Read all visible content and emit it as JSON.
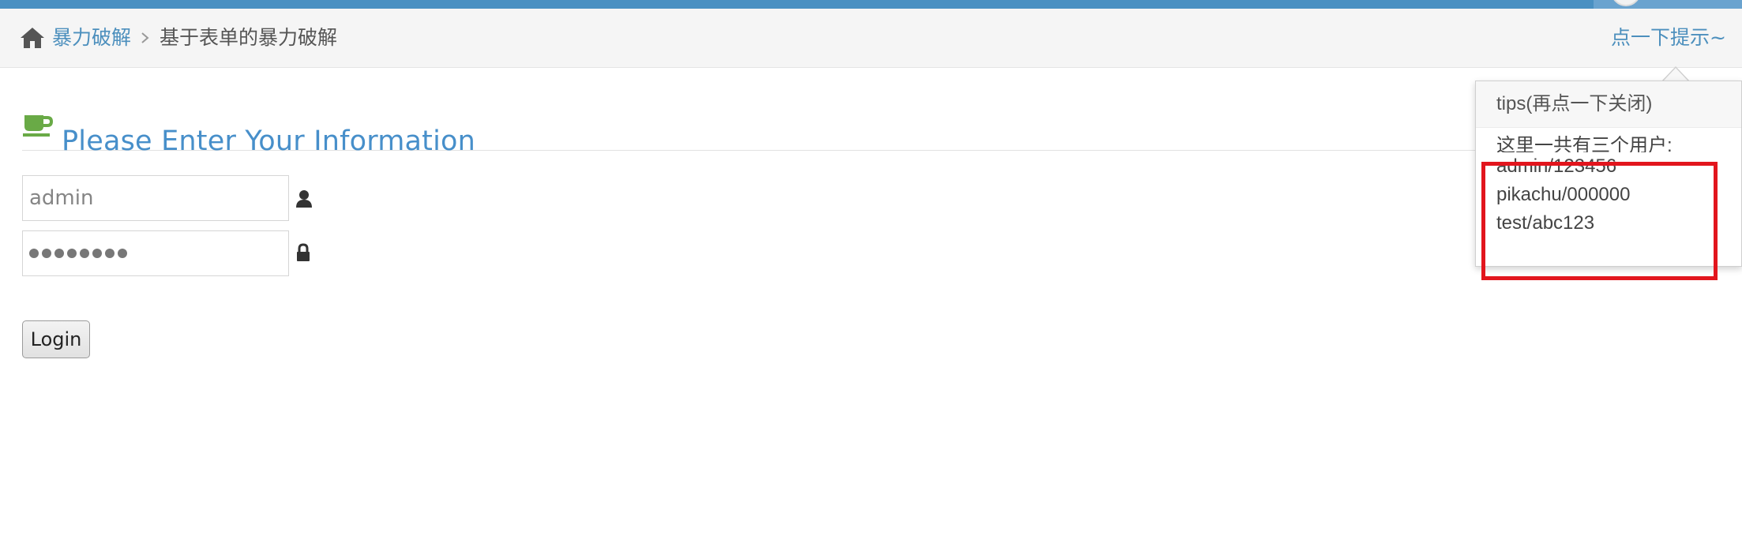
{
  "breadcrumbs": {
    "parent": "暴力破解",
    "current": "基于表单的暴力破解",
    "hint_link": "点一下提示~"
  },
  "page": {
    "title": "Please Enter Your Information"
  },
  "form": {
    "username_value": "admin",
    "password_mask": "••••••••",
    "login_label": "Login"
  },
  "popover": {
    "title": "tips(再点一下关闭)",
    "intro": "这里一共有三个用户:",
    "credentials": "admin/123456 pikachu/000000 test/abc123"
  },
  "colors": {
    "link": "#4c8fbd",
    "title": "#478fca",
    "highlight": "#e2151d",
    "top_bar": "#4a90c2"
  }
}
